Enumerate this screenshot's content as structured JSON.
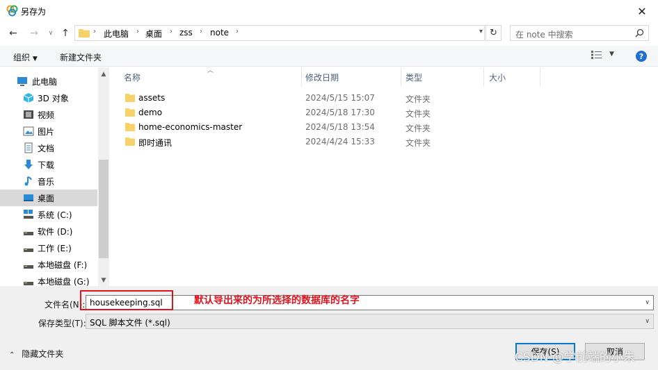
{
  "window": {
    "title": "另存为"
  },
  "address": {
    "breadcrumbs": [
      "此电脑",
      "桌面",
      "zss",
      "note"
    ],
    "search_placeholder": "在 note 中搜索"
  },
  "toolbar": {
    "organize": "组织",
    "new_folder": "新建文件夹"
  },
  "sidebar": {
    "items": [
      {
        "label": "此电脑",
        "icon": "computer-icon"
      },
      {
        "label": "3D 对象",
        "icon": "cube-3d-icon"
      },
      {
        "label": "视频",
        "icon": "video-icon"
      },
      {
        "label": "图片",
        "icon": "picture-icon"
      },
      {
        "label": "文档",
        "icon": "document-icon"
      },
      {
        "label": "下载",
        "icon": "download-icon"
      },
      {
        "label": "音乐",
        "icon": "music-icon"
      },
      {
        "label": "桌面",
        "icon": "desktop-icon"
      },
      {
        "label": "系统 (C:)",
        "icon": "system-drive-icon"
      },
      {
        "label": "软件 (D:)",
        "icon": "drive-icon"
      },
      {
        "label": "工作 (E:)",
        "icon": "drive-icon"
      },
      {
        "label": "本地磁盘 (F:)",
        "icon": "drive-icon"
      },
      {
        "label": "本地磁盘 (G:)",
        "icon": "drive-icon"
      }
    ]
  },
  "columns": {
    "name": "名称",
    "date": "修改日期",
    "type": "类型",
    "size": "大小"
  },
  "files": [
    {
      "name": "assets",
      "date": "2024/5/15 15:07",
      "type": "文件夹"
    },
    {
      "name": "demo",
      "date": "2024/5/18 17:30",
      "type": "文件夹"
    },
    {
      "name": "home-economics-master",
      "date": "2024/5/18 13:54",
      "type": "文件夹"
    },
    {
      "name": "即时通讯",
      "date": "2024/4/24 15:33",
      "type": "文件夹"
    }
  ],
  "form": {
    "filename_label": "文件名(N):",
    "filename_value": "housekeeping.sql",
    "filetype_label": "保存类型(T):",
    "filetype_value": "SQL 脚本文件 (*.sql)"
  },
  "annotation": "默认导出来的为所选择的数据库的名字",
  "footer": {
    "hide_folders": "隐藏文件夹",
    "save": "保存(S)",
    "cancel": "取消"
  },
  "watermark": "CSDN @学前端的小朱",
  "colors": {
    "accent": "#0078d7",
    "annotation": "#e0141e",
    "folder": "#f7d26b"
  }
}
